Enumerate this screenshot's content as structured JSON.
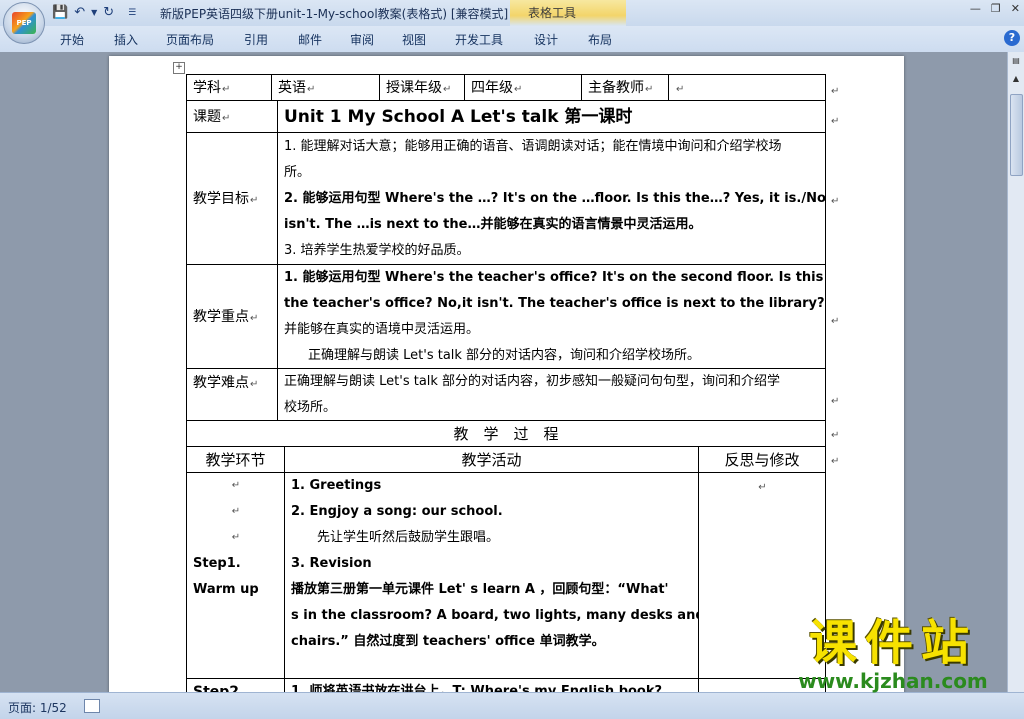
{
  "window": {
    "title": "新版PEP英语四级下册unit-1-My-school教案(表格式) [兼容模式] M",
    "context_tab": "表格工具",
    "office_logo": "PEP"
  },
  "ribbon": {
    "tabs": [
      "开始",
      "插入",
      "页面布局",
      "引用",
      "邮件",
      "审阅",
      "视图",
      "开发工具",
      "设计",
      "布局"
    ]
  },
  "table": {
    "row1": {
      "subject_label": "学科",
      "subject": "英语",
      "grade_label": "授课年级",
      "grade": "四年级",
      "teacher_label": "主备教师"
    },
    "topic": {
      "label": "课题",
      "value": "Unit 1 My School   A   Let's talk   第一课时"
    },
    "goals": {
      "label": "教学目标",
      "lines": [
        "1. 能理解对话大意；能够用正确的语音、语调朗读对话；能在情境中询问和介绍学校场",
        "所。",
        "2. 能够运用句型 Where's the …? It's on the …floor. Is this the…? Yes, it is./No,it",
        "isn't. The …is next to the…并能够在真实的语言情景中灵活运用。",
        "3. 培养学生热爱学校的好品质。"
      ]
    },
    "key": {
      "label": "教学重点",
      "lines": [
        "1. 能够运用句型 Where's the teacher's office? It's on the second floor. Is this",
        "the teacher's office? No,it isn't. The teacher's office is next to the library?",
        "并能够在真实的语境中灵活运用。",
        "正确理解与朗读 Let's talk 部分的对话内容，询问和介绍学校场所。"
      ]
    },
    "difficult": {
      "label": "教学难点",
      "lines": [
        "正确理解与朗读 Let's talk 部分的对话内容，初步感知一般疑问句句型，询问和介绍学",
        "校场所。"
      ]
    },
    "process_title": "教　学　过　程",
    "headers": [
      "教学环节",
      "教学活动",
      "反思与修改"
    ],
    "step1": {
      "label_line1": "Step1.",
      "label_line2": "Warm up",
      "lines": [
        "1. Greetings",
        "2. Engjoy a song: our school.",
        "先让学生听然后鼓励学生跟唱。",
        "3. Revision",
        "播放第三册第一单元课件 Let' s learn A ，回顾句型：“What'",
        "s in the classroom? A board, two lights, many desks and",
        "chairs.” 自然过度到 teachers' office 单词教学。"
      ]
    },
    "step2": {
      "label": "Step2.",
      "line": "1. 师将英语书放在讲台上，T: Where's my English book?"
    }
  },
  "status": {
    "page": "页面: 1/52"
  },
  "watermark": {
    "main": "课件站",
    "url": "www.kjzhan.com"
  },
  "colors": {
    "watermark_main": "#f7e200",
    "watermark_url": "#2b8b1e",
    "ribbon_bg": "#cddcf0"
  }
}
